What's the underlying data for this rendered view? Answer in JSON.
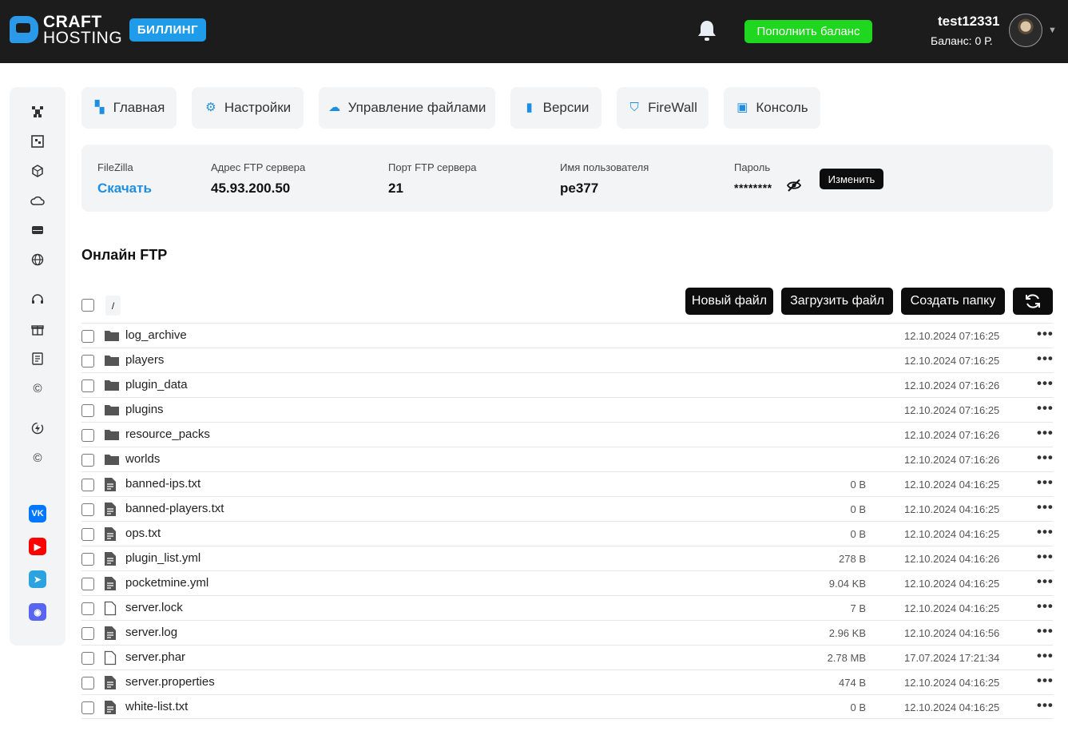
{
  "header": {
    "logo_line1": "CRAFT",
    "logo_line2": "HOSTING",
    "billing_label": "БИЛЛИНГ",
    "topup_label": "Пополнить баланс",
    "username": "test12331",
    "balance": "Баланс: 0 Р."
  },
  "sidebar": {
    "icons": [
      "minecraft-icon",
      "grid-icon",
      "cube-icon",
      "cloud-icon",
      "server-icon",
      "globe-icon",
      "headset-icon",
      "gift-icon",
      "document-icon",
      "copyright-icon",
      "bolt-icon",
      "copyright-icon"
    ],
    "socials": [
      {
        "name": "vk-icon",
        "label": "VK",
        "color": "#0077ff"
      },
      {
        "name": "youtube-icon",
        "label": "▶",
        "color": "#ff0000"
      },
      {
        "name": "telegram-icon",
        "label": "➤",
        "color": "#2aa3e0"
      },
      {
        "name": "discord-icon",
        "label": "◉",
        "color": "#5865f2"
      }
    ]
  },
  "tabs": [
    {
      "label": "Главная",
      "icon": "▚"
    },
    {
      "label": "Настройки",
      "icon": "⚙"
    },
    {
      "label": "Управление файлами",
      "icon": "☁"
    },
    {
      "label": "Версии",
      "icon": "▮"
    },
    {
      "label": "FireWall",
      "icon": "⛉"
    },
    {
      "label": "Консоль",
      "icon": "▣"
    }
  ],
  "ftp": {
    "filezilla_label": "FileZilla",
    "filezilla_link": "Скачать",
    "address_label": "Адрес FTP сервера",
    "address": "45.93.200.50",
    "port_label": "Порт FTP сервера",
    "port": "21",
    "user_label": "Имя пользователя",
    "user": "pe377",
    "password_label": "Пароль",
    "password_mask": "********",
    "change_label": "Изменить"
  },
  "online": {
    "title": "Онлайн FTP",
    "path": "/",
    "new_file": "Новый файл",
    "upload": "Загрузить файл",
    "new_folder": "Создать папку"
  },
  "files": [
    {
      "name": "log_archive",
      "type": "folder",
      "size": "",
      "date": "12.10.2024 07:16:25"
    },
    {
      "name": "players",
      "type": "folder",
      "size": "",
      "date": "12.10.2024 07:16:25"
    },
    {
      "name": "plugin_data",
      "type": "folder",
      "size": "",
      "date": "12.10.2024 07:16:26"
    },
    {
      "name": "plugins",
      "type": "folder",
      "size": "",
      "date": "12.10.2024 07:16:25"
    },
    {
      "name": "resource_packs",
      "type": "folder",
      "size": "",
      "date": "12.10.2024 07:16:26"
    },
    {
      "name": "worlds",
      "type": "folder",
      "size": "",
      "date": "12.10.2024 07:16:26"
    },
    {
      "name": "banned-ips.txt",
      "type": "text",
      "size": "0 B",
      "date": "12.10.2024 04:16:25"
    },
    {
      "name": "banned-players.txt",
      "type": "text",
      "size": "0 B",
      "date": "12.10.2024 04:16:25"
    },
    {
      "name": "ops.txt",
      "type": "text",
      "size": "0 B",
      "date": "12.10.2024 04:16:25"
    },
    {
      "name": "plugin_list.yml",
      "type": "text",
      "size": "278 B",
      "date": "12.10.2024 04:16:26"
    },
    {
      "name": "pocketmine.yml",
      "type": "text",
      "size": "9.04 KB",
      "date": "12.10.2024 04:16:25"
    },
    {
      "name": "server.lock",
      "type": "blank",
      "size": "7 B",
      "date": "12.10.2024 04:16:25"
    },
    {
      "name": "server.log",
      "type": "text",
      "size": "2.96 KB",
      "date": "12.10.2024 04:16:56"
    },
    {
      "name": "server.phar",
      "type": "blank",
      "size": "2.78 MB",
      "date": "17.07.2024 17:21:34"
    },
    {
      "name": "server.properties",
      "type": "text",
      "size": "474 B",
      "date": "12.10.2024 04:16:25"
    },
    {
      "name": "white-list.txt",
      "type": "text",
      "size": "0 B",
      "date": "12.10.2024 04:16:25"
    }
  ],
  "more_glyph": "•••"
}
